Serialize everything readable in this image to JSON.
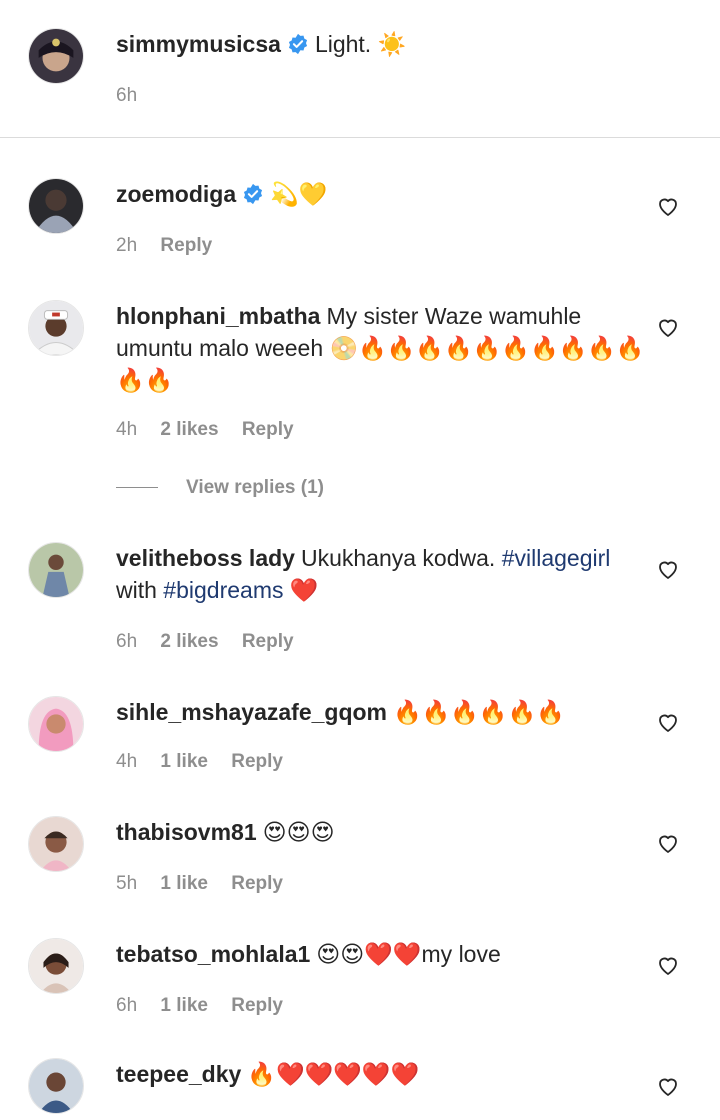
{
  "caption": {
    "username": "simmymusicsa",
    "text": "Light. ☀️",
    "time": "6h"
  },
  "comments": [
    {
      "username": "zoemodiga",
      "verified": true,
      "text": "💫💛",
      "time": "2h",
      "likes": "",
      "reply": "Reply"
    },
    {
      "username": "hlonphani_mbatha",
      "text": "My sister Waze wamuhle umuntu malo weeeh 📀🔥🔥🔥🔥🔥🔥🔥🔥🔥🔥🔥🔥",
      "time": "4h",
      "likes": "2 likes",
      "reply": "Reply",
      "view_replies": "View replies (1)"
    },
    {
      "username": "velitheboss lady",
      "text_before": "Ukukhanya kodwa. ",
      "tag1": "#villagegirl",
      "text_mid": " with ",
      "tag2": "#bigdreams",
      "text_after": " ❤️",
      "time": "6h",
      "likes": "2 likes",
      "reply": "Reply"
    },
    {
      "username": "sihle_mshayazafe_gqom",
      "text": "🔥🔥🔥🔥🔥🔥",
      "time": "4h",
      "likes": "1 like",
      "reply": "Reply"
    },
    {
      "username": "thabisovm81",
      "text": "😍😍😍",
      "time": "5h",
      "likes": "1 like",
      "reply": "Reply"
    },
    {
      "username": "tebatso_mohlala1",
      "text": "😍😍❤️❤️my love",
      "time": "6h",
      "likes": "1 like",
      "reply": "Reply"
    },
    {
      "username": "teepee_dky",
      "text": "🔥❤️❤️❤️❤️❤️",
      "time": "",
      "likes": "",
      "reply": ""
    }
  ],
  "colors": {
    "verified": "#3897f0",
    "hashtag": "#1f3a70",
    "meta": "#8e8e8e"
  }
}
